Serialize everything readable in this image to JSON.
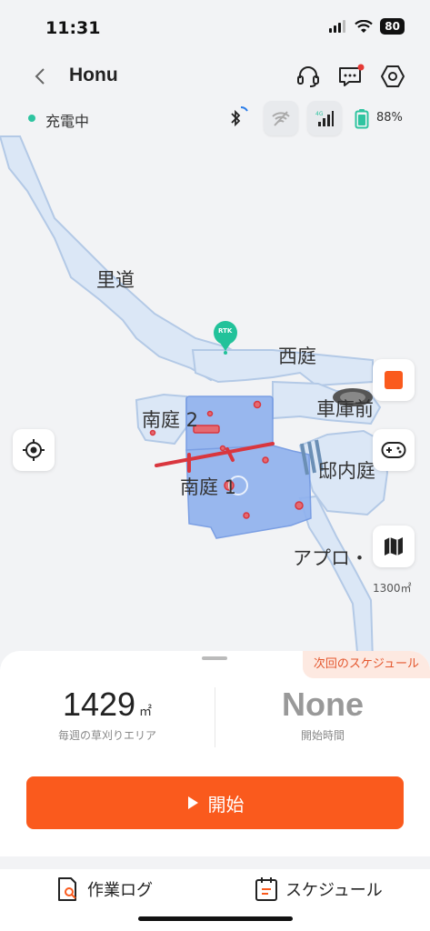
{
  "status_bar": {
    "time": "11:31",
    "battery": "80"
  },
  "header": {
    "title": "Honu"
  },
  "info": {
    "status": "充電中",
    "battery_percent": "88%"
  },
  "map": {
    "labels": {
      "sato_michi": "里道",
      "nishi_niwa": "西庭",
      "minami_niwa_2": "南庭 2",
      "shako_mae": "車庫前",
      "teinai": "邸内庭",
      "minami_niwa_1": "南庭 1",
      "approach": "アプロ・"
    },
    "rtk_badge": "RTK",
    "total_area": "1300㎡"
  },
  "sheet": {
    "next_schedule": "次回のスケジュール",
    "weekly_area_value": "1429",
    "weekly_area_unit": "㎡",
    "weekly_area_caption": "毎週の草刈りエリア",
    "start_time_value": "None",
    "start_time_caption": "開始時間",
    "start_button": "開始"
  },
  "tabs": {
    "work_log": "作業ログ",
    "schedule": "スケジュール"
  },
  "colors": {
    "accent": "#fa5a1d",
    "status_green": "#2ec4a0",
    "map_zone": "#dbe7f6",
    "map_zone_selected": "#8fb1ee",
    "boundary_red": "#d9363e"
  }
}
